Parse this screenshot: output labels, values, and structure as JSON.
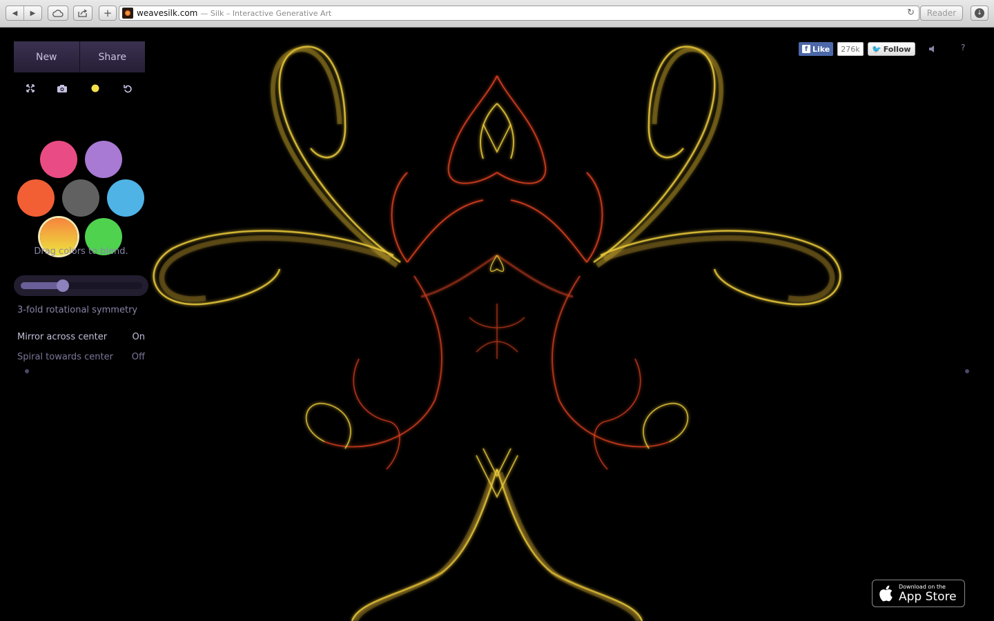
{
  "browser": {
    "domain": "weavesilk.com",
    "page_title": "— Silk – Interactive Generative Art",
    "reader_label": "Reader",
    "back_icon": "back-arrow-icon",
    "forward_icon": "forward-arrow-icon",
    "cloud_icon": "icloud-icon",
    "share_icon": "share-icon",
    "newtab_icon": "plus-icon",
    "reload_icon": "reload-icon",
    "downloads_icon": "download-icon"
  },
  "panel": {
    "new_label": "New",
    "share_label": "Share",
    "tools": [
      "fullscreen-icon",
      "camera-icon",
      "color-dot-icon",
      "undo-icon"
    ],
    "colors": [
      {
        "name": "pink",
        "color": "#e94c84"
      },
      {
        "name": "purple",
        "color": "#a87ad3"
      },
      {
        "name": "orange",
        "color": "#f25f35"
      },
      {
        "name": "gray",
        "color": "#616161"
      },
      {
        "name": "blue",
        "color": "#4fb3e6"
      },
      {
        "name": "orange-yellow",
        "color": "#f79c3d",
        "selected": true
      },
      {
        "name": "green",
        "color": "#4fd34f"
      }
    ],
    "hint": "Drag colors to blend.",
    "symmetry_level": 0.33,
    "symmetry_label": "3-fold rotational symmetry",
    "mirror_label": "Mirror across center",
    "mirror_value": "On",
    "spiral_label": "Spiral towards center",
    "spiral_value": "Off"
  },
  "social": {
    "like_label": "Like",
    "like_count": "276k",
    "follow_label": "Follow",
    "sound_icon": "speaker-icon",
    "help_label": "?"
  },
  "appstore": {
    "small_text": "Download on the",
    "big_text": "App Store",
    "icon": "apple-icon"
  },
  "colors": {
    "accent": "#3a3150",
    "silk_yellow": "#e9c83a",
    "silk_red": "#e2421f"
  }
}
